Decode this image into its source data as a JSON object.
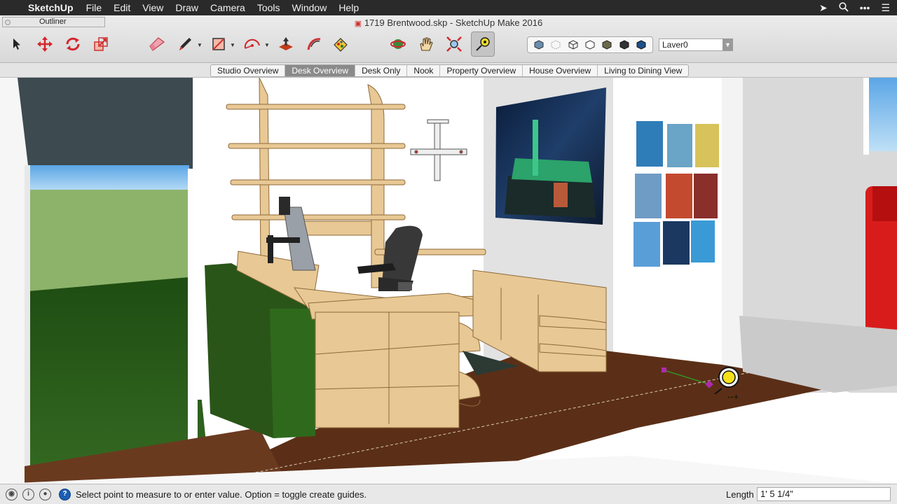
{
  "menubar": {
    "app": "SketchUp",
    "items": [
      "File",
      "Edit",
      "View",
      "Draw",
      "Camera",
      "Tools",
      "Window",
      "Help"
    ]
  },
  "window": {
    "title": "1719 Brentwood.skp - SketchUp Make 2016"
  },
  "outliner": {
    "title": "Outliner"
  },
  "tools": [
    "select-icon",
    "move-icon",
    "rotate-icon",
    "scale-icon",
    "eraser-icon",
    "pencil-icon",
    "rectangle-icon",
    "arc-icon",
    "push-pull-icon",
    "follow-me-icon",
    "paint-bucket-icon",
    "orbit-icon",
    "pan-icon",
    "zoom-extents-icon",
    "tape-measure-icon"
  ],
  "layer": {
    "value": "Laver0"
  },
  "scenes": {
    "tabs": [
      "Studio Overview",
      "Desk Overview",
      "Desk Only",
      "Nook",
      "Property Overview",
      "House Overview",
      "Living to Dining View"
    ],
    "active": "Desk Overview"
  },
  "status": {
    "message": "Select point to measure to or enter value.  Option = toggle create guides.",
    "length_label": "Length",
    "length_value": "1' 5 1/4\""
  },
  "colors": {
    "accent": "#1a5fb4",
    "floor": "#5b2f17",
    "desk": "#e8c894",
    "green_panel": "#2d5d1a"
  }
}
